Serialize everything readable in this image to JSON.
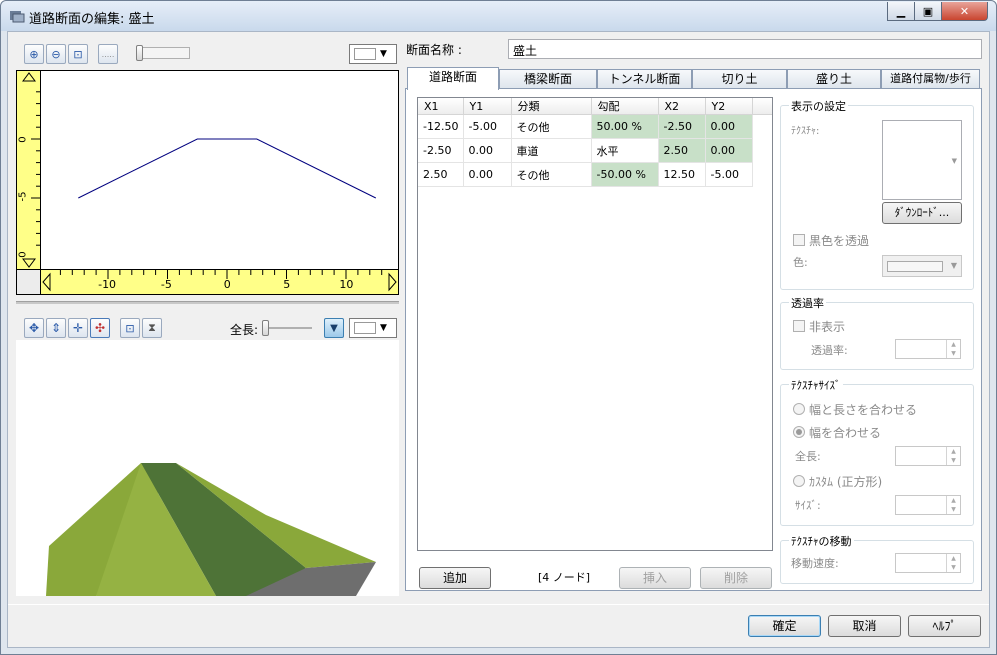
{
  "window": {
    "title": "道路断面の編集: 盛土"
  },
  "section_name": {
    "label": "断面名称 :",
    "value": "盛土"
  },
  "view2d": {
    "x_ticks": [
      "-10",
      "-5",
      "0",
      "5",
      "10"
    ],
    "y_ticks": [
      "0",
      "-5",
      "0"
    ]
  },
  "view3d": {
    "length_label": "全長:"
  },
  "tabs": [
    "道路断面",
    "橋梁断面",
    "トンネル断面",
    "切り土",
    "盛り土",
    "道路付属物/歩行"
  ],
  "grid": {
    "columns": [
      "X1",
      "Y1",
      "分類",
      "勾配",
      "X2",
      "Y2"
    ],
    "rows": [
      [
        "-12.50",
        "-5.00",
        "その他",
        "50.00 %",
        "-2.50",
        "0.00"
      ],
      [
        "-2.50",
        "0.00",
        "車道",
        "水平",
        "2.50",
        "0.00"
      ],
      [
        "2.50",
        "0.00",
        "その他",
        "-50.00 %",
        "12.50",
        "-5.00"
      ]
    ]
  },
  "node_count": "[4 ノード]",
  "buttons": {
    "add": "追加",
    "insert": "挿入",
    "delete": "削除",
    "ok": "確定",
    "cancel": "取消",
    "help": "ﾍﾙﾌﾟ",
    "download": "ﾀﾞｳﾝﾛｰﾄﾞ..."
  },
  "display": {
    "title": "表示の設定",
    "texture_label": "ﾃｸｽﾁｬ:",
    "black_transparent": "黒色を透過",
    "color_label": "色:"
  },
  "transparency": {
    "title": "透過率",
    "hide": "非表示",
    "rate_label": "透過率:"
  },
  "texture_size": {
    "title": "ﾃｸｽﾁｬｻｲｽﾞ",
    "fit_both": "幅と長さを合わせる",
    "fit_width": "幅を合わせる",
    "length_label": "全長:",
    "custom": "ｶｽﾀﾑ (正方形)",
    "size_label": "ｻｲｽﾞ:"
  },
  "texture_move": {
    "title": "ﾃｸｽﾁｬの移動",
    "speed_label": "移動速度:"
  },
  "profile": {
    "points": [
      [
        -12.5,
        -5
      ],
      [
        -2.5,
        0
      ],
      [
        2.5,
        0
      ],
      [
        12.5,
        -5
      ]
    ],
    "color": "#00007f"
  }
}
